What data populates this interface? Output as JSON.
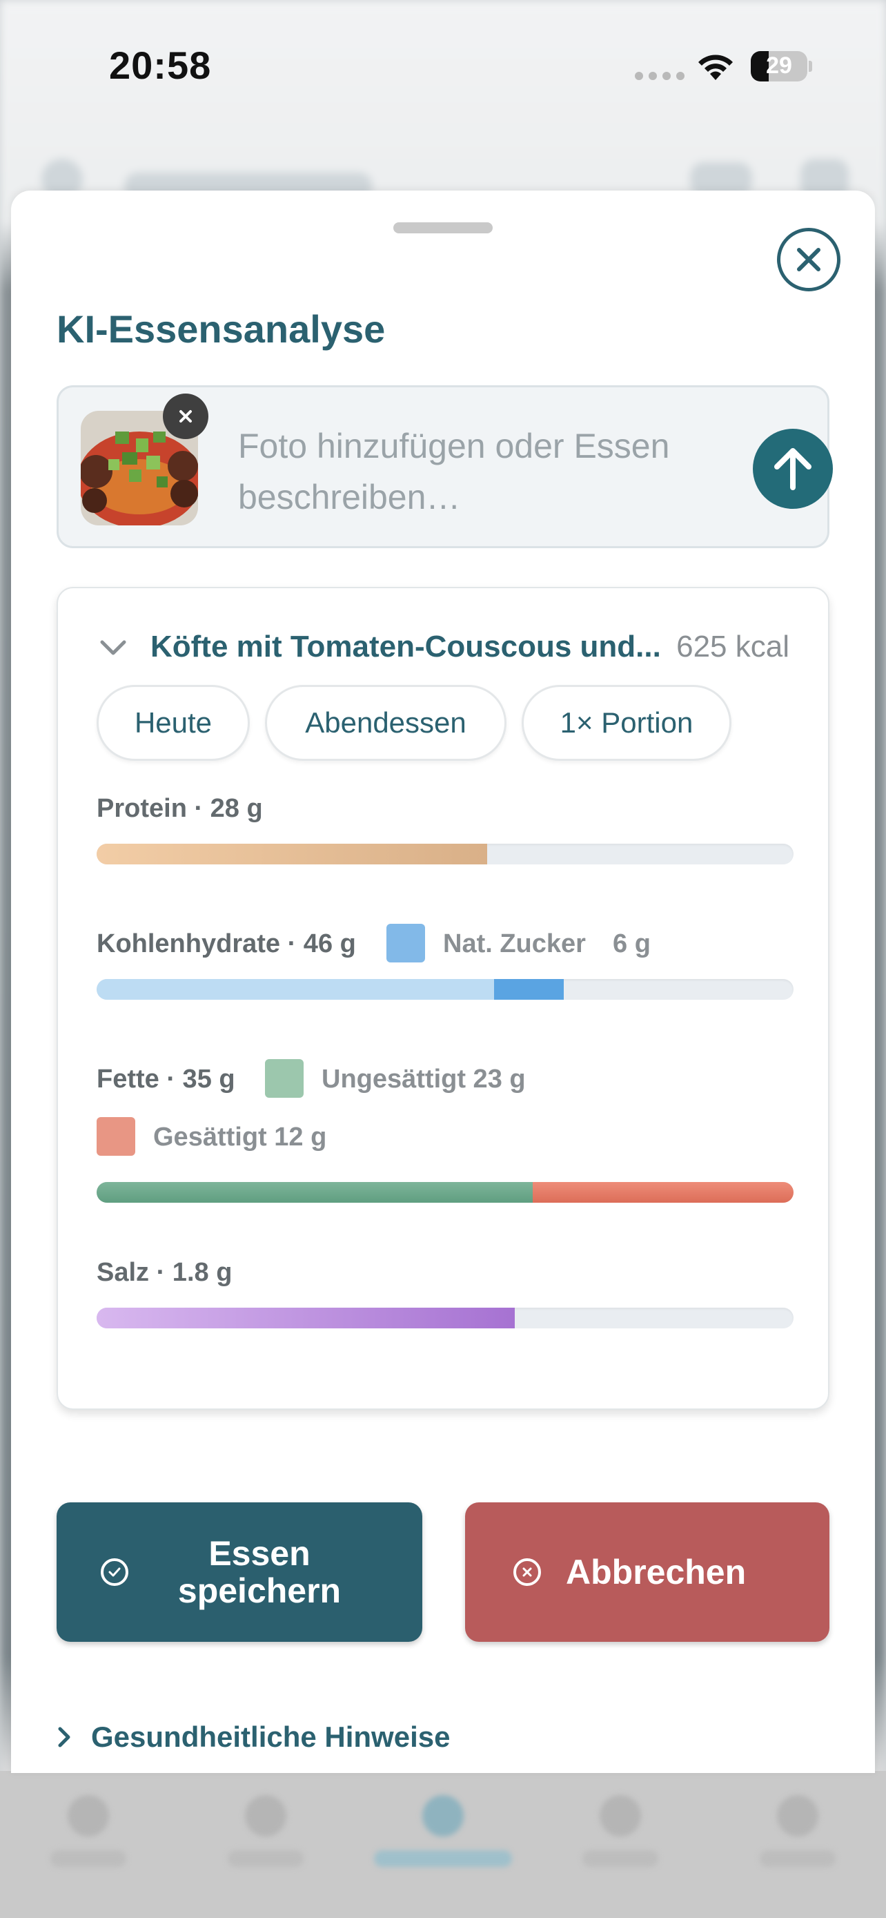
{
  "status_bar": {
    "time": "20:58",
    "battery": "29"
  },
  "sheet": {
    "title": "KI-Essensanalyse",
    "input": {
      "placeholder": "Foto hinzufügen oder Essen beschreiben…",
      "photo_alt": "Köfte mit Tomaten-Couscous"
    },
    "result": {
      "meal_name": "Köfte mit Tomaten-Couscous und...",
      "kcal": "625 kcal",
      "chips": [
        {
          "label": "Heute"
        },
        {
          "label": "Abendessen"
        },
        {
          "label": "1× Portion"
        }
      ],
      "macros": {
        "protein": {
          "label": "Protein · 28 g",
          "fraction": 0.56
        },
        "carbs": {
          "label": "Kohlenhydrate · 46 g",
          "sugar_label": "Nat. Zucker",
          "sugar_value": "6 g",
          "fraction": 0.67,
          "sugar_fraction": 0.1
        },
        "fat": {
          "label": "Fette · 35 g",
          "unsat_label": "Ungesättigt 23 g",
          "sat_label": "Gesättigt 12 g",
          "unsat_fraction": 0.626,
          "sat_fraction": 0.374
        },
        "salt": {
          "label": "Salz · 1.8 g",
          "fraction": 0.6
        }
      }
    },
    "buttons": {
      "save_label": "Essen speichern",
      "cancel_label": "Abbrechen"
    },
    "hints_label": "Gesundheitliche Hinweise"
  },
  "colors": {
    "primary": "#2b6170",
    "send": "#236b78",
    "save_button": "#2b5f6e",
    "cancel_button": "#b85b5b",
    "protein": "#d9b088",
    "carbs": "#b9d9f2",
    "sugar": "#5aa4e2",
    "unsaturated": "#6aa88c",
    "saturated": "#e07a68",
    "salt": "#b07ad6"
  }
}
